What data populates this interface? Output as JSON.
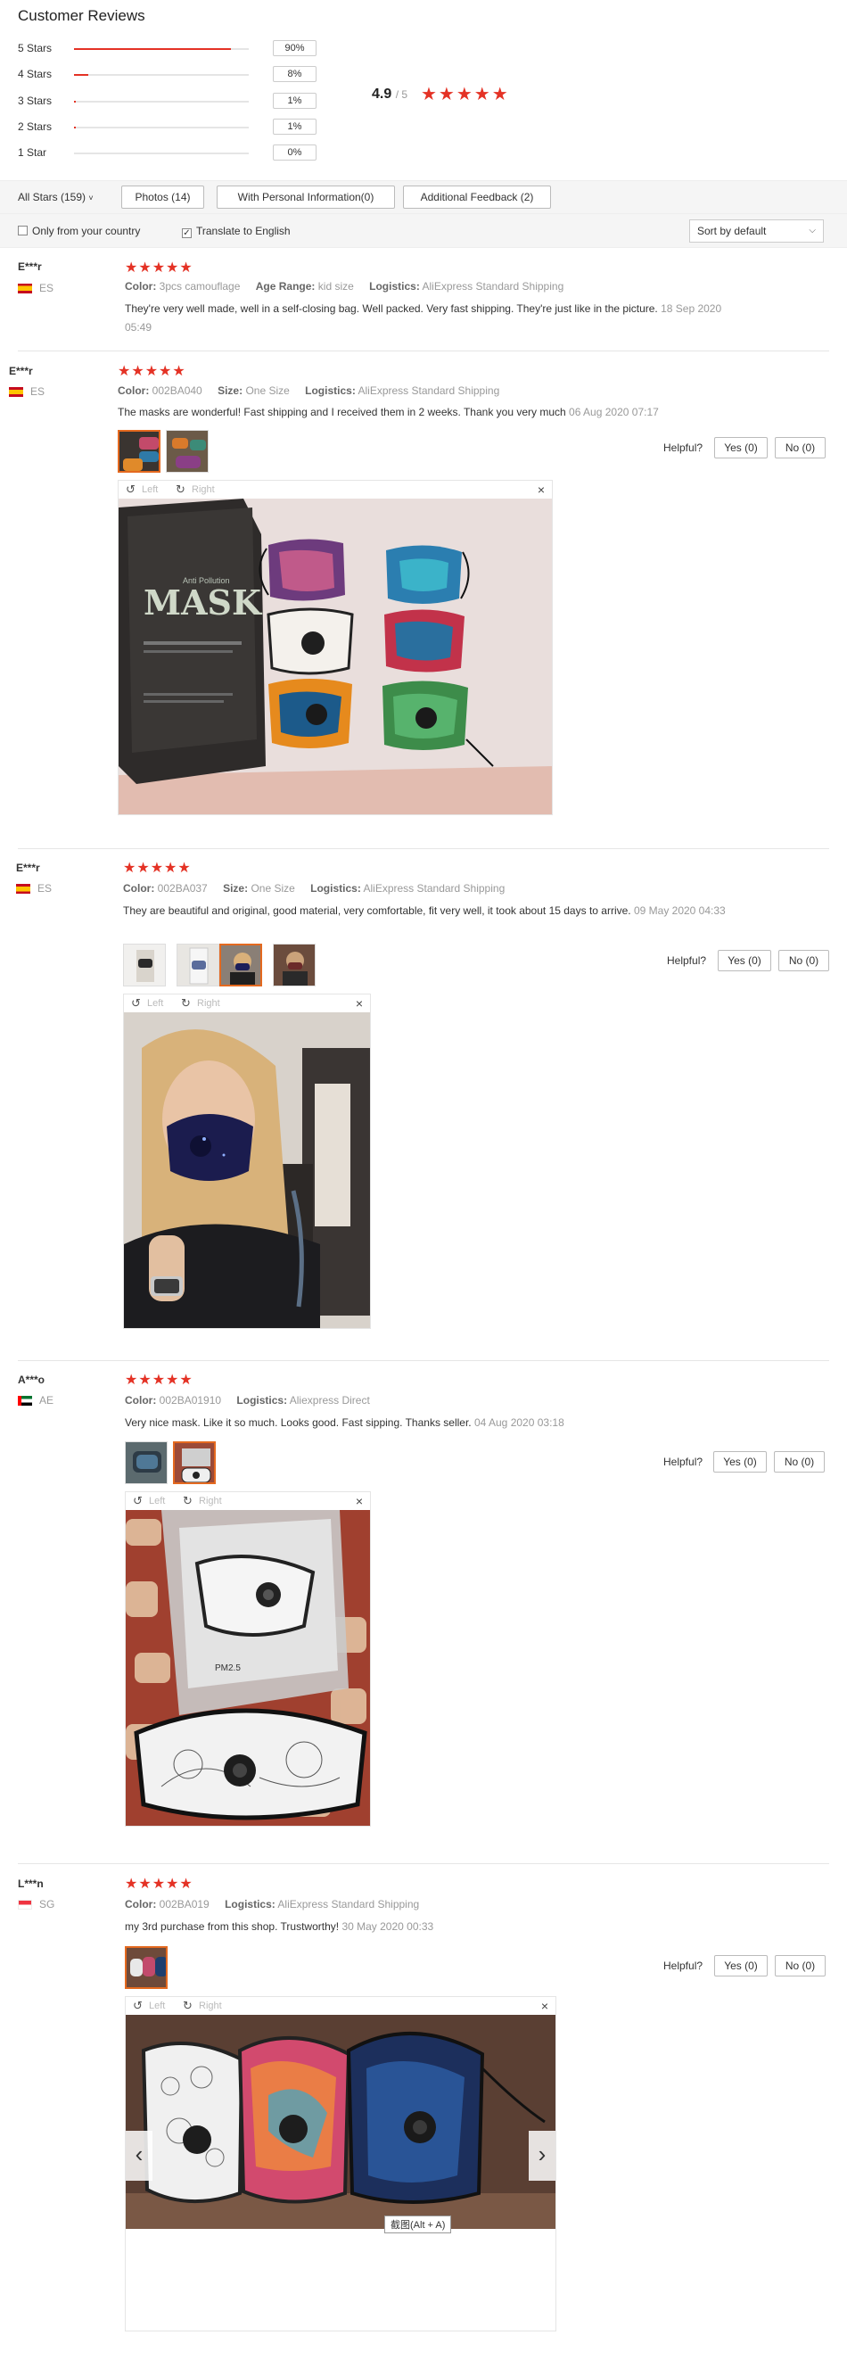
{
  "header": {
    "title": "Customer Reviews"
  },
  "distribution": [
    {
      "label": "5 Stars",
      "percent": "90%",
      "fraction": 0.9
    },
    {
      "label": "4 Stars",
      "percent": "8%",
      "fraction": 0.08
    },
    {
      "label": "3 Stars",
      "percent": "1%",
      "fraction": 0.01
    },
    {
      "label": "2 Stars",
      "percent": "1%",
      "fraction": 0.01
    },
    {
      "label": "1 Star",
      "percent": "0%",
      "fraction": 0.0
    }
  ],
  "overall": {
    "score": "4.9",
    "out_of": "/ 5",
    "stars": "★★★★★"
  },
  "filters": {
    "all_stars": "All Stars (159)",
    "photos": "Photos (14)",
    "personal_info": "With Personal Information(0)",
    "additional": "Additional Feedback (2)"
  },
  "options": {
    "only_country": "Only from your country",
    "translate": "Translate to English",
    "sort": "Sort by default"
  },
  "viewer": {
    "left": "Left",
    "right": "Right",
    "close": "×"
  },
  "helpful": {
    "label": "Helpful?",
    "yes": "Yes (0)",
    "no": "No (0)"
  },
  "tooltip": "截图(Alt + A)",
  "colors": {
    "accent": "#e43225",
    "thumb_active": "#e4691f"
  },
  "reviews": [
    {
      "user": "E***r",
      "country": "ES",
      "stars": "★★★★★",
      "attrs": [
        {
          "label": "Color:",
          "value": "3pcs camouflage"
        },
        {
          "label": "Age Range:",
          "value": "kid size"
        },
        {
          "label": "Logistics:",
          "value": "AliExpress Standard Shipping"
        }
      ],
      "text": "They're very well made, well in a self-closing bag. Well packed. Very fast shipping. They're just like in the picture.",
      "date": "18 Sep 2020 05:49"
    },
    {
      "user": "E***r",
      "country": "ES",
      "stars": "★★★★★",
      "attrs": [
        {
          "label": "Color:",
          "value": "002BA040"
        },
        {
          "label": "Size:",
          "value": "One Size"
        },
        {
          "label": "Logistics:",
          "value": "AliExpress Standard Shipping"
        }
      ],
      "text": "The masks are wonderful! Fast shipping and I received them in 2 weeks. Thank you very much",
      "date": "06 Aug 2020 07:17",
      "photo_text": {
        "brand": "MASK",
        "sub": "Anti Pollution"
      }
    },
    {
      "user": "E***r",
      "country": "ES",
      "stars": "★★★★★",
      "attrs": [
        {
          "label": "Color:",
          "value": "002BA037"
        },
        {
          "label": "Size:",
          "value": "One Size"
        },
        {
          "label": "Logistics:",
          "value": "AliExpress Standard Shipping"
        }
      ],
      "text": "They are beautiful and original, good material, very comfortable, fit very well, it took about 15 days to arrive.",
      "date": "09 May 2020 04:33"
    },
    {
      "user": "A***o",
      "country": "AE",
      "stars": "★★★★★",
      "attrs": [
        {
          "label": "Color:",
          "value": "002BA01910"
        },
        {
          "label": "Logistics:",
          "value": "Aliexpress Direct"
        }
      ],
      "text": "Very nice mask. Like it so much. Looks good. Fast sipping. Thanks seller.",
      "date": "04 Aug 2020 03:18",
      "photo_text": {
        "pm": "PM2.5"
      }
    },
    {
      "user": "L***n",
      "country": "SG",
      "stars": "★★★★★",
      "attrs": [
        {
          "label": "Color:",
          "value": "002BA019"
        },
        {
          "label": "Logistics:",
          "value": "AliExpress Standard Shipping"
        }
      ],
      "text": "my 3rd purchase from this shop. Trustworthy!",
      "date": "30 May 2020 00:33"
    }
  ]
}
